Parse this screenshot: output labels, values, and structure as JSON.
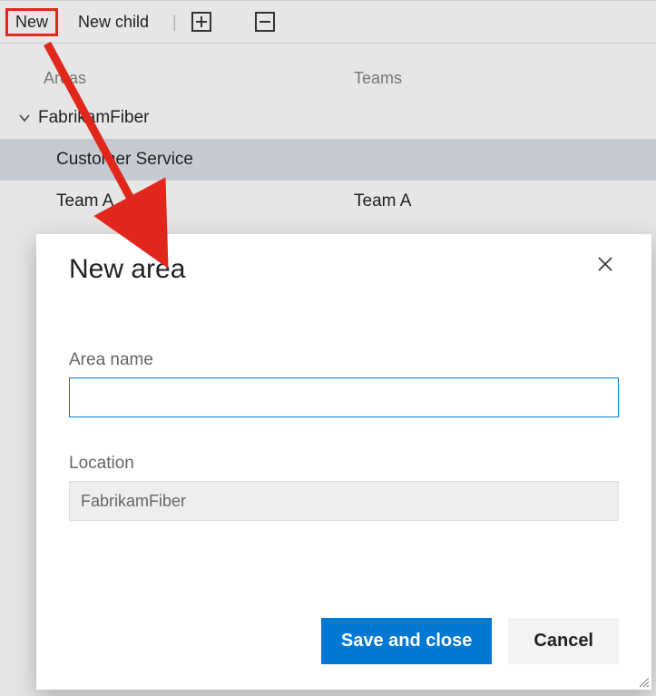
{
  "toolbar": {
    "new_label": "New",
    "new_child_label": "New child"
  },
  "columns": {
    "areas": "Areas",
    "teams": "Teams"
  },
  "tree": {
    "root": {
      "label": "FabrikamFiber",
      "expanded": true
    },
    "children": [
      {
        "label": "Customer Service",
        "team": "",
        "selected": true
      },
      {
        "label": "Team A",
        "team": "Team A",
        "selected": false
      }
    ]
  },
  "dialog": {
    "title": "New area",
    "area_name_label": "Area name",
    "area_name_value": "",
    "location_label": "Location",
    "location_value": "FabrikamFiber",
    "save_label": "Save and close",
    "cancel_label": "Cancel"
  }
}
